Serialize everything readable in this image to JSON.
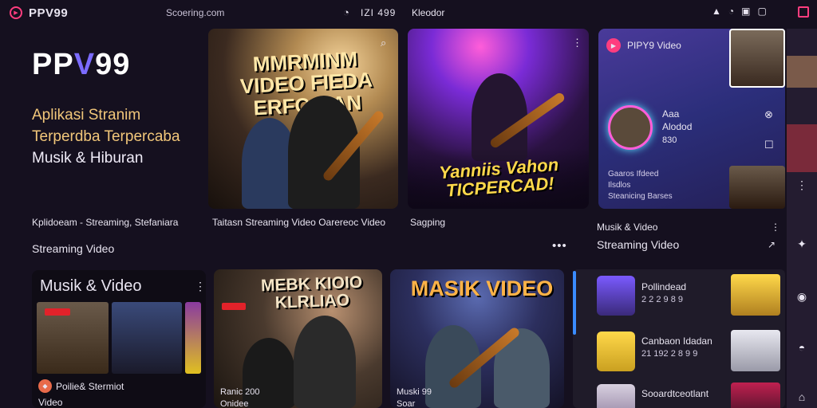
{
  "topbar": {
    "brand": "PPV99",
    "site": "Scoering.com",
    "clock": "IZI 499",
    "keyboard": "Kleodor"
  },
  "hero": {
    "logo": "PPV99",
    "tagline_1": "Aplikasi Stranim",
    "tagline_2": "Terperdba Terpercaba",
    "tagline_3": "Musik & Hiburan"
  },
  "cards": {
    "card_1_title": "MMRMINM VIDEO FIEDA ERFCGIAN",
    "card_2_title": "Yanniis Vahon TICPERCAD!",
    "card_3_title": "MEBK KIOIO KLRLIAO",
    "card_4_title": "MASIK VIDEO"
  },
  "labels": {
    "row_1_a": "Kplidoeam - Streaming, Stefaniara",
    "row_1_b": "Taitasn Streaming Video Oarereoc Video",
    "row_1_c": "Sagping",
    "section": "Streaming Video"
  },
  "profile": {
    "title": "PIPY9 Video",
    "name": "Aaa",
    "sub": "Alodod",
    "num": "830",
    "list_1": "Gaaros Ifdeed",
    "list_2": "Ilsdlos",
    "list_3": "Steanicing Barses",
    "section_1": "Musik & Video",
    "section_2": "Streaming Video"
  },
  "music_panel": {
    "title": "Musik & Video",
    "foot_1": "Poilie& Stermiot",
    "foot_2": "Video"
  },
  "card_3_foot": {
    "line_1": "Ranic 200",
    "line_2": "Onidee"
  },
  "card_4_foot": {
    "line_1": "Muski 99",
    "line_2": "Soar"
  },
  "list": [
    {
      "title": "Pollindead",
      "sub": "2 2 2 9 8 9"
    },
    {
      "title": "Canbaon Idadan",
      "sub": "21 192 2 8 9 9"
    },
    {
      "title": "Sooardtceotlant",
      "sub": ""
    }
  ],
  "colors": {
    "accent": "#ff3d7f",
    "panel": "#2b2e7a",
    "gold": "#f2c77a"
  }
}
